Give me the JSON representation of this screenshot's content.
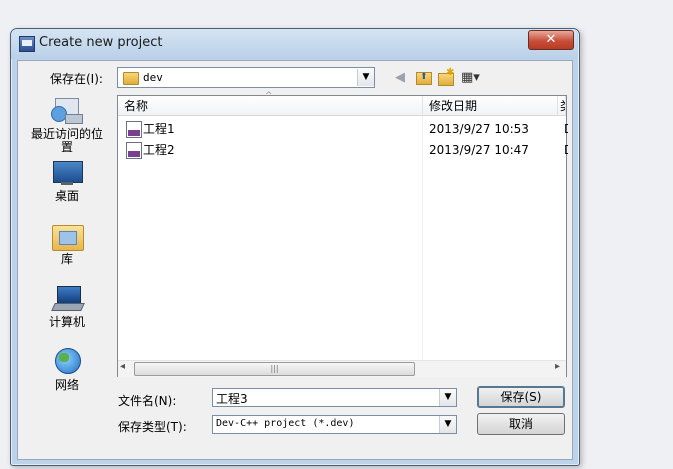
{
  "window": {
    "title": "Create new project",
    "close_label": "✕"
  },
  "location": {
    "label": "保存在(I):",
    "value": "dev"
  },
  "places": [
    {
      "label": "最近访问的位置",
      "icon": "recent-places-icon"
    },
    {
      "label": "桌面",
      "icon": "desktop-icon"
    },
    {
      "label": "库",
      "icon": "libraries-icon"
    },
    {
      "label": "计算机",
      "icon": "computer-icon"
    },
    {
      "label": "网络",
      "icon": "network-icon"
    }
  ],
  "list": {
    "columns": [
      "名称",
      "修改日期",
      "类"
    ],
    "rows": [
      {
        "name": "工程1",
        "modified": "2013/9/27 10:53",
        "type": "D"
      },
      {
        "name": "工程2",
        "modified": "2013/9/27 10:47",
        "type": "D"
      }
    ]
  },
  "filename": {
    "label": "文件名(N):",
    "value": "工程3"
  },
  "filetype": {
    "label": "保存类型(T):",
    "value": "Dev-C++ project (*.dev)"
  },
  "buttons": {
    "save": "保存(S)",
    "cancel": "取消"
  },
  "glyphs": {
    "dropdown": "▼",
    "sort_up": "^",
    "scroll_left": "◂",
    "scroll_right": "▸",
    "grip": "|||",
    "back": "◀",
    "up_folder": "⬆",
    "new_folder": "✱",
    "views": "▦▾"
  }
}
